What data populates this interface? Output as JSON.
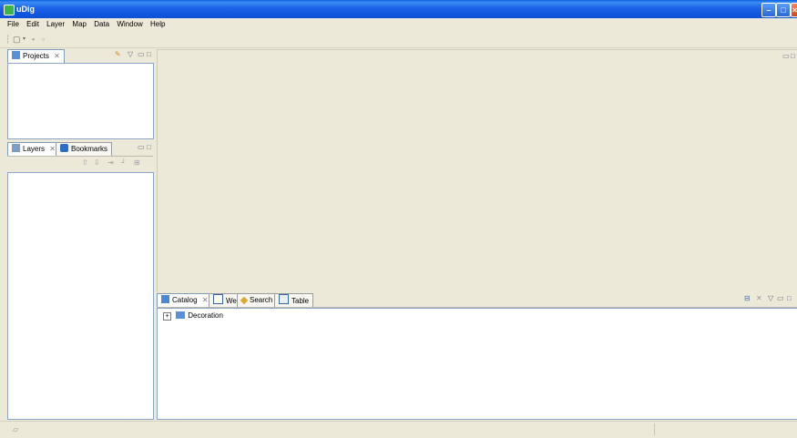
{
  "window": {
    "title": "uDig"
  },
  "menu": [
    "File",
    "Edit",
    "Layer",
    "Map",
    "Data",
    "Window",
    "Help"
  ],
  "views": {
    "projects": {
      "tab_label": "Projects"
    },
    "layers": {
      "tab_label": "Layers"
    },
    "bookmarks": {
      "tab_label": "Bookmarks"
    },
    "catalog": {
      "tab_label": "Catalog"
    },
    "web": {
      "tab_label": "Web"
    },
    "search": {
      "tab_label": "Search"
    },
    "table": {
      "tab_label": "Table"
    }
  },
  "catalog_tree": [
    {
      "label": "Decoration",
      "expander": "+"
    }
  ],
  "icons": {
    "projects": "projects-icon",
    "layers": "layers-icon",
    "bookmarks": "bookmarks-icon",
    "catalog": "catalog-icon",
    "web": "web-icon",
    "search": "search-icon",
    "table": "table-icon"
  },
  "colors": {
    "titlebar": "#0b50d8",
    "chrome": "#ece9d8",
    "panel_border": "#8fa5c8"
  }
}
